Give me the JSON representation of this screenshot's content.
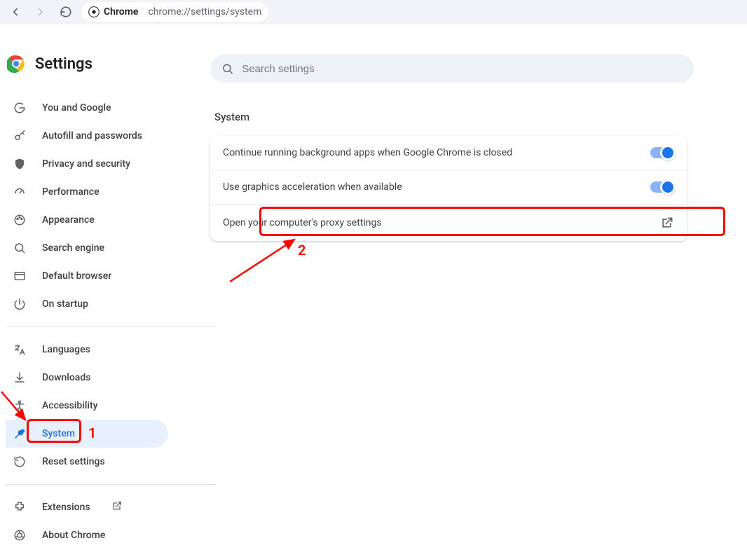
{
  "navbar": {
    "url": "chrome://settings/system",
    "chip_label": "Chrome"
  },
  "brand": {
    "title": "Settings"
  },
  "search": {
    "placeholder": "Search settings"
  },
  "sidebar": {
    "group1": [
      {
        "label": "You and Google"
      },
      {
        "label": "Autofill and passwords"
      },
      {
        "label": "Privacy and security"
      },
      {
        "label": "Performance"
      },
      {
        "label": "Appearance"
      },
      {
        "label": "Search engine"
      },
      {
        "label": "Default browser"
      },
      {
        "label": "On startup"
      }
    ],
    "group2": [
      {
        "label": "Languages"
      },
      {
        "label": "Downloads"
      },
      {
        "label": "Accessibility"
      },
      {
        "label": "System"
      },
      {
        "label": "Reset settings"
      }
    ],
    "group3": [
      {
        "label": "Extensions"
      },
      {
        "label": "About Chrome"
      }
    ]
  },
  "section": {
    "title": "System"
  },
  "rows": {
    "r0": {
      "label": "Continue running background apps when Google Chrome is closed",
      "on": true
    },
    "r1": {
      "label": "Use graphics acceleration when available",
      "on": true
    },
    "r2": {
      "label": "Open your computer's proxy settings"
    }
  },
  "annotations": {
    "label1": "1",
    "label2": "2"
  },
  "colors": {
    "accent": "#1a73e8",
    "annotation": "#ff0000"
  }
}
